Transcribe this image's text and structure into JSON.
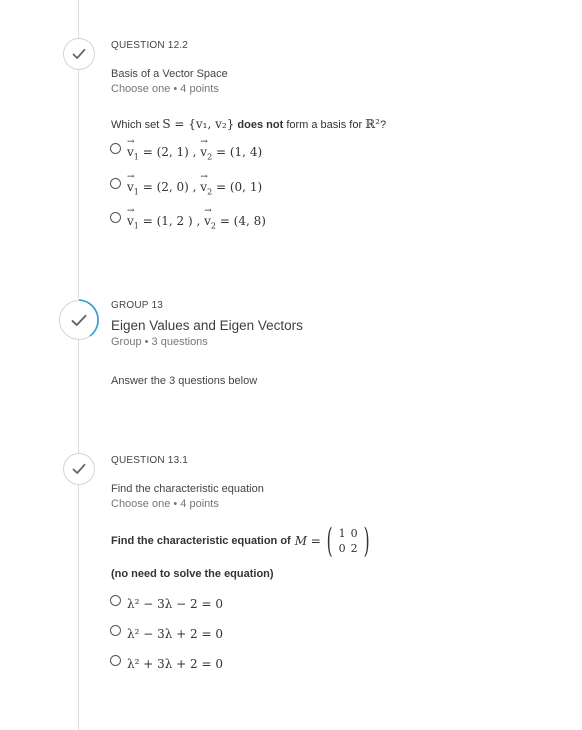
{
  "colors": {
    "accent": "#2a9fd6",
    "rail": "#dcdcdc",
    "check": "#666666"
  },
  "q12_2": {
    "kicker": "QUESTION 12.2",
    "title": "Basis of a Vector Space",
    "meta": "Choose one • 4 points",
    "prompt_prefix": "Which set",
    "prompt_set": "S = {v₁, v₂}",
    "prompt_bold": "does not",
    "prompt_suffix": "form a basis for",
    "prompt_space": "ℝ²",
    "prompt_end": "?",
    "options": [
      {
        "v1": "= (2, 1) ,",
        "v2": "= (1, 4)"
      },
      {
        "v1": "= (2, 0) ,",
        "v2": "= (0, 1)"
      },
      {
        "v1": "= (1, 2 ) ,",
        "v2": "= (4, 8)"
      }
    ]
  },
  "group13": {
    "kicker": "GROUP 13",
    "title": "Eigen Values and Eigen Vectors",
    "meta": "Group • 3 questions",
    "description": "Answer the 3 questions below"
  },
  "q13_1": {
    "kicker": "QUESTION 13.1",
    "title": "Find the characteristic equation",
    "meta": "Choose one • 4 points",
    "prompt": "Find the characteristic equation of",
    "matrix_label": "M =",
    "matrix": [
      [
        "1",
        "0"
      ],
      [
        "0",
        "2"
      ]
    ],
    "note": "(no need to solve the equation)",
    "options": [
      "λ² − 3λ − 2 = 0",
      "λ² − 3λ + 2 = 0",
      "λ² + 3λ + 2 = 0"
    ]
  }
}
